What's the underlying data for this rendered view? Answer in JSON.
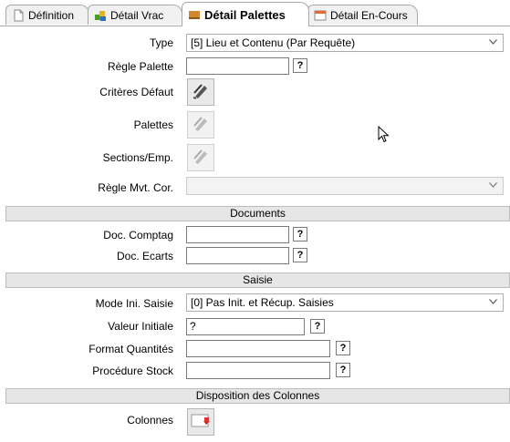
{
  "tabs": [
    {
      "label": "Définition"
    },
    {
      "label": "Détail Vrac"
    },
    {
      "label": "Détail Palettes"
    },
    {
      "label": "Détail En-Cours"
    }
  ],
  "form": {
    "type": {
      "label": "Type",
      "value": "[5] Lieu et Contenu (Par Requête)"
    },
    "regle_palette": {
      "label": "Règle Palette",
      "value": ""
    },
    "criteres_defaut": {
      "label": "Critères Défaut"
    },
    "palettes": {
      "label": "Palettes"
    },
    "sections_emp": {
      "label": "Sections/Emp."
    },
    "regle_mvt": {
      "label": "Règle Mvt. Cor.",
      "value": ""
    }
  },
  "documents": {
    "title": "Documents",
    "doc_comptage": {
      "label": "Doc. Comptag",
      "value": ""
    },
    "doc_ecarts": {
      "label": "Doc. Ecarts",
      "value": ""
    }
  },
  "saisie": {
    "title": "Saisie",
    "mode_ini": {
      "label": "Mode Ini. Saisie",
      "value": "[0] Pas Init. et Récup. Saisies"
    },
    "valeur_initiale": {
      "label": "Valeur Initiale",
      "value": "?"
    },
    "format_quantites": {
      "label": "Format Quantités",
      "value": ""
    },
    "procedure_stock": {
      "label": "Procédure Stock",
      "value": ""
    }
  },
  "disposition": {
    "title": "Disposition des Colonnes",
    "colonnes": {
      "label": "Colonnes"
    }
  },
  "help_button_label": "?",
  "icons": {
    "definition": "document-icon",
    "detail_vrac": "bulk-items-icon",
    "detail_palettes": "pallet-icon",
    "detail_en_cours": "window-icon",
    "criteres": "pencil-edit-icon",
    "colonnes": "columns-icon"
  }
}
